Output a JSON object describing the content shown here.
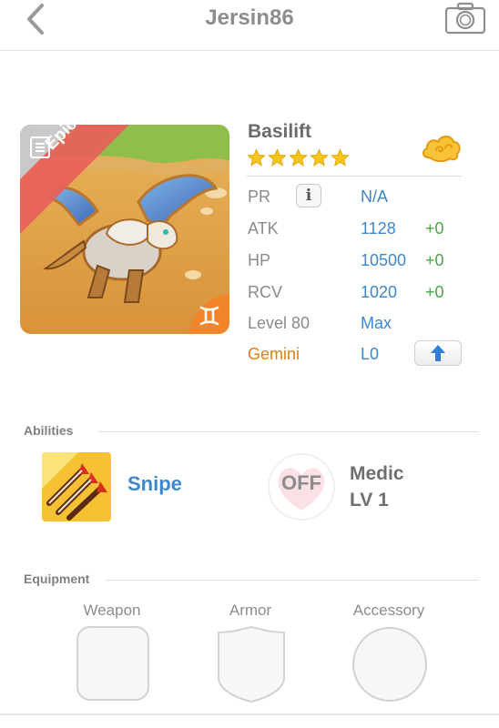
{
  "header": {
    "title": "Jersin86",
    "back_icon": "chevron-left-icon",
    "camera_icon": "camera-icon"
  },
  "creature": {
    "name": "Basilift",
    "rarity": "Epic",
    "stars": 5,
    "sign_icon": "gemini-icon",
    "currency_icon": "gold-cloud-icon",
    "colors": {
      "rarity_ribbon": "#e8615a",
      "accent_blue": "#3e87cc",
      "bonus_green": "#4aa64a",
      "sign_orange": "#e07f16"
    }
  },
  "stats": {
    "pr": {
      "label": "PR",
      "value": "N/A"
    },
    "atk": {
      "label": "ATK",
      "value": "1128",
      "bonus": "+0"
    },
    "hp": {
      "label": "HP",
      "value": "10500",
      "bonus": "+0"
    },
    "rcv": {
      "label": "RCV",
      "value": "1020",
      "bonus": "+0"
    },
    "level": {
      "label": "Level 80",
      "value": "Max"
    },
    "sign": {
      "label": "Gemini",
      "value": "L0"
    }
  },
  "abilities": {
    "title": "Abilities",
    "active": {
      "name": "Snipe",
      "icon": "arrows-icon"
    },
    "leader": {
      "state": "OFF",
      "name": "Medic",
      "level": "LV 1"
    }
  },
  "equipment": {
    "title": "Equipment",
    "slots": [
      {
        "label": "Weapon",
        "icon": "rounded-square-slot"
      },
      {
        "label": "Armor",
        "icon": "shield-slot"
      },
      {
        "label": "Accessory",
        "icon": "circle-slot"
      }
    ]
  }
}
